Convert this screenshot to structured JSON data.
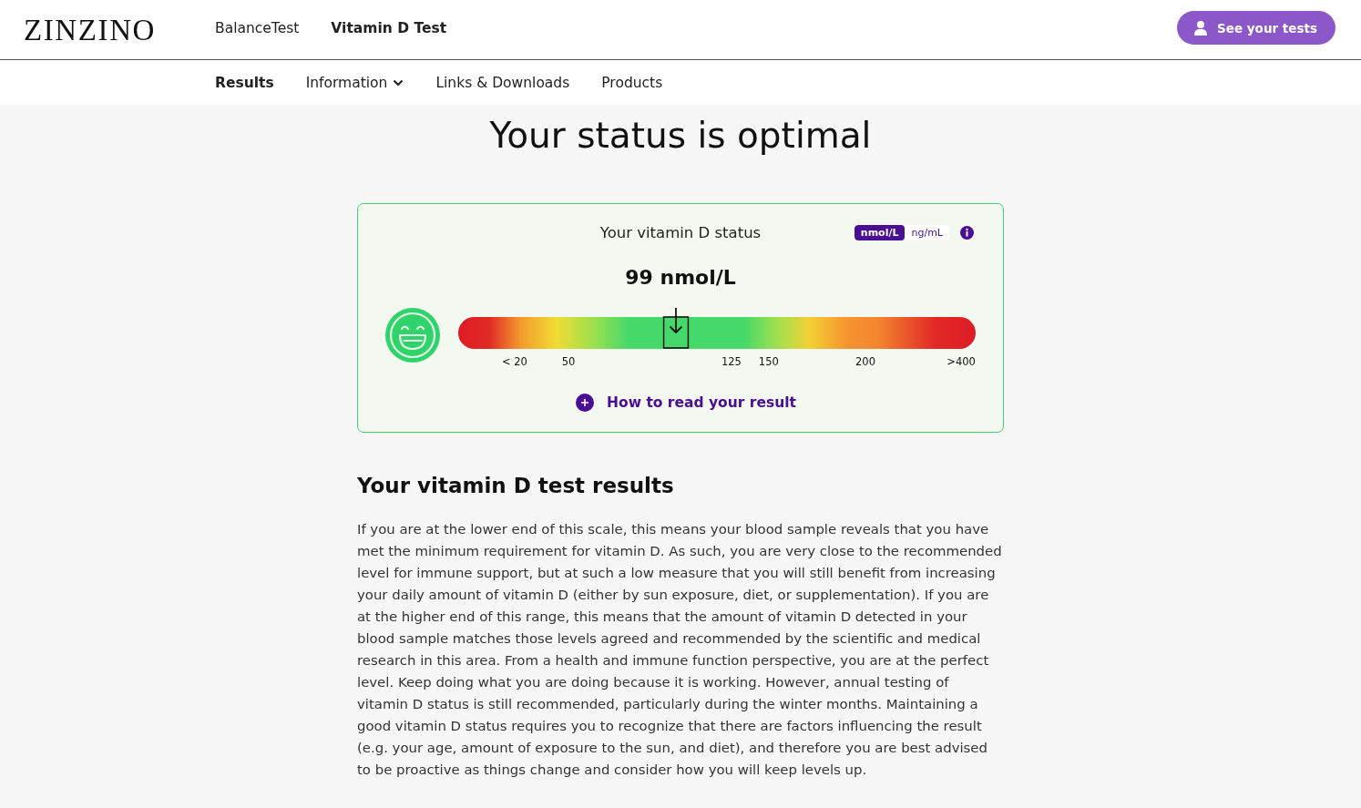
{
  "header": {
    "logo": "ZINZINO",
    "nav": [
      {
        "label": "BalanceTest",
        "selected": false
      },
      {
        "label": "Vitamin D Test",
        "selected": true
      }
    ],
    "account_button": "See your tests"
  },
  "subnav": [
    {
      "label": "Results",
      "selected": true,
      "kind": "link"
    },
    {
      "label": "Information",
      "selected": false,
      "kind": "dropdown"
    },
    {
      "label": "Links & Downloads",
      "selected": false,
      "kind": "link"
    },
    {
      "label": "Products",
      "selected": false,
      "kind": "link"
    }
  ],
  "title": "Your status is optimal",
  "status_card": {
    "heading": "Your vitamin D status",
    "units": [
      {
        "label": "nmol/L",
        "selected": true
      },
      {
        "label": "ng/mL",
        "selected": false
      }
    ],
    "value": "99 nmol/L",
    "gauge": {
      "level": 0.42,
      "ticks": [
        "< 20",
        "50",
        "125",
        "150",
        "200",
        ">400"
      ]
    },
    "expand_link": "How to read your result"
  },
  "results": {
    "heading": "Your vitamin D test results",
    "paragraph": "If you are at the lower end of this scale, this means your blood sample reveals that you have met the minimum requirement for vitamin D. As such, you are very close to the recommended level for immune support, but at such a low measure that you will still benefit from increasing your daily amount of vitamin D (either by sun exposure, diet, or supplementation). If you are at the higher end of this range, this means that the amount of vitamin D detected in your blood sample matches those levels agreed and recommended by the scientific and medical research in this area. From a health and immune function perspective, you are at the perfect level. Keep doing what you are doing because it is working. However, annual testing of vitamin D status is still recommended, particularly during the winter months. Maintaining a good vitamin D status requires you to recognize that there are factors influencing the result (e.g. your age, amount of exposure to the sun, and diet), and therefore you are best advised to be proactive as things change and consider how you will keep levels up."
  }
}
